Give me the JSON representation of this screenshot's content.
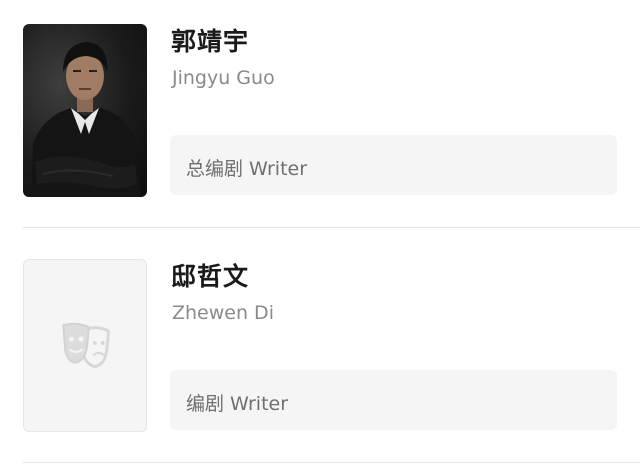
{
  "cast": [
    {
      "name_cn": "郭靖宇",
      "name_en": "Jingyu Guo",
      "role": "总编剧 Writer",
      "has_photo": true
    },
    {
      "name_cn": "邸哲文",
      "name_en": "Zhewen Di",
      "role": "编剧 Writer",
      "has_photo": false,
      "placeholder_icon": "theater-masks-icon"
    }
  ],
  "colors": {
    "name": "#1a1a1a",
    "subtitle": "#8a8a8a",
    "role_bg": "#f5f5f5",
    "role_text": "#6f6f6f",
    "divider": "#e3e3e3"
  }
}
